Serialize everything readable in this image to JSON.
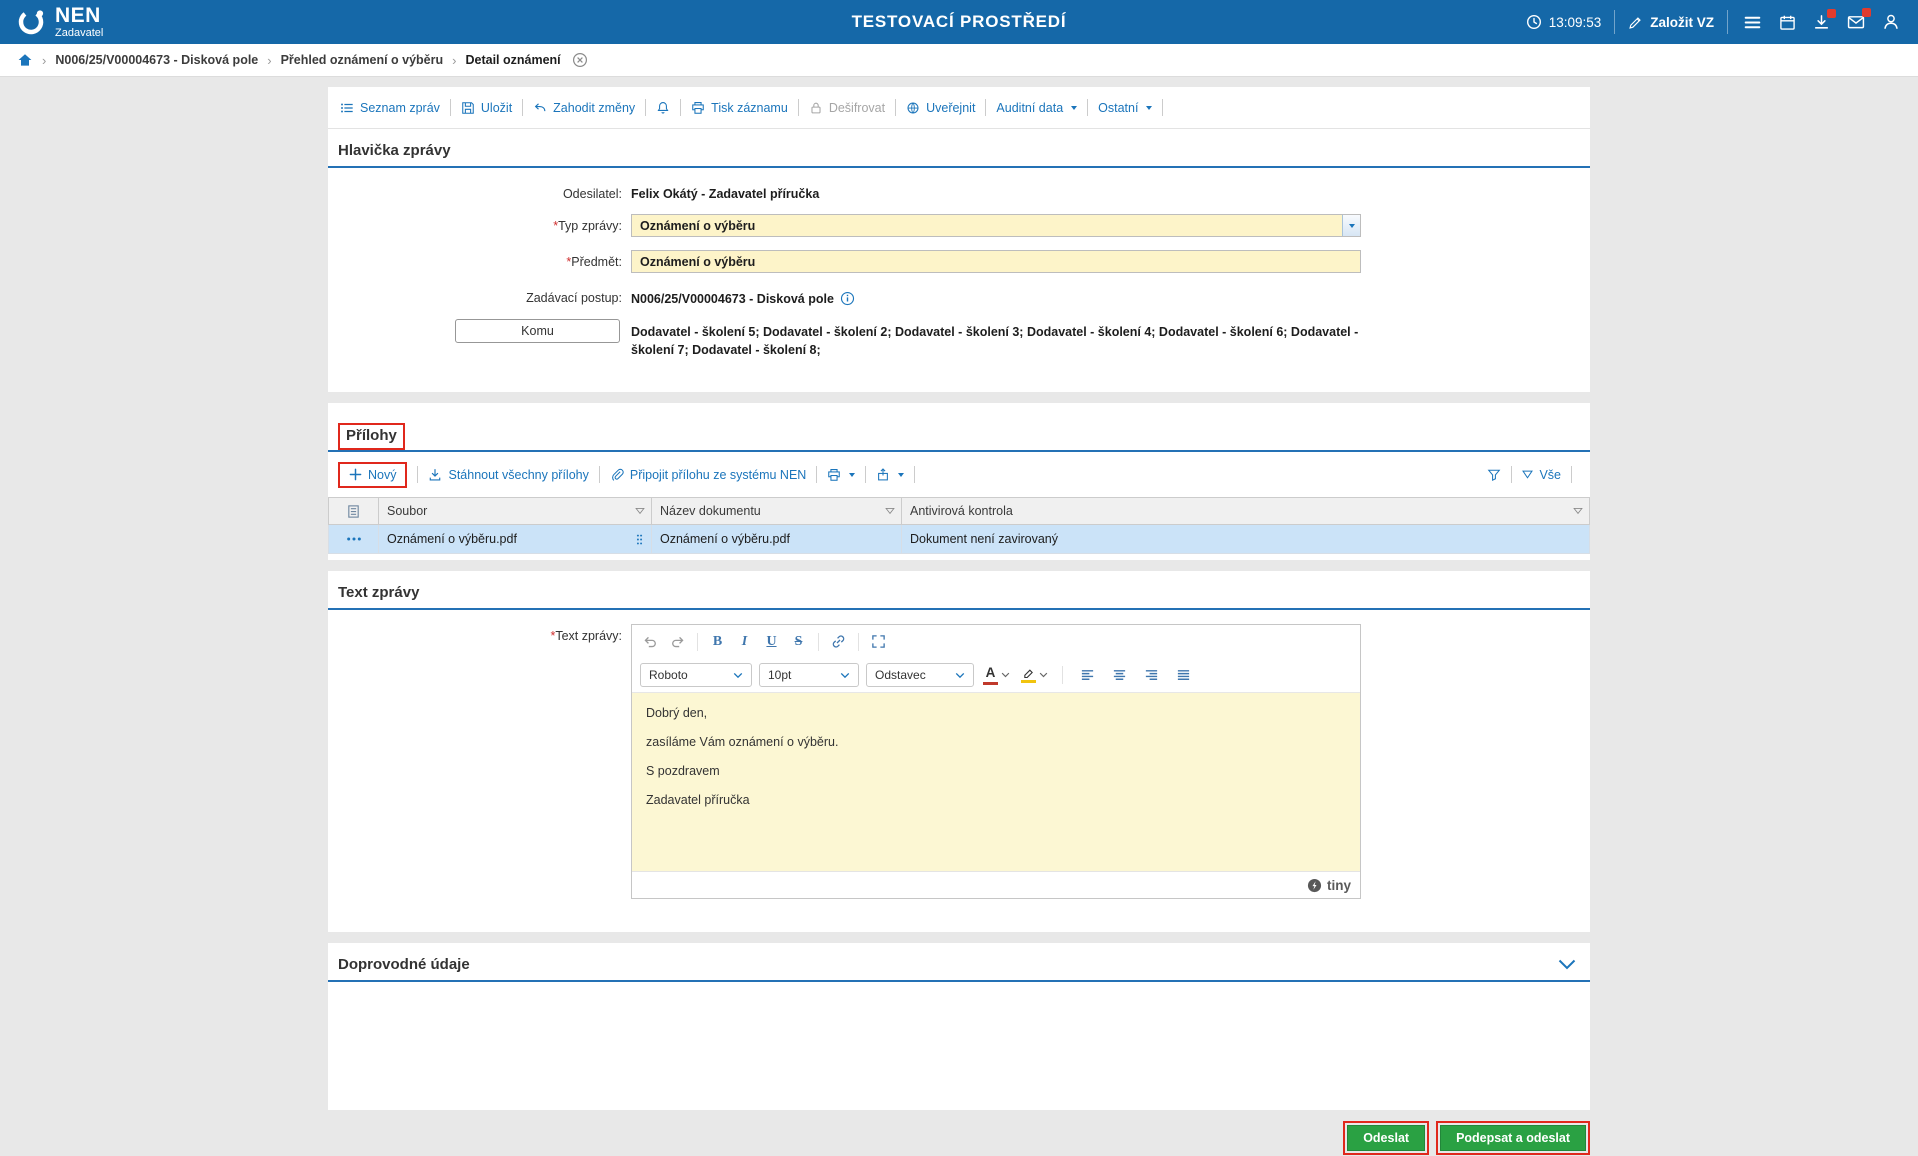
{
  "topbar": {
    "brand": "NEN",
    "brand_sub": "Zadavatel",
    "environment": "TESTOVACÍ PROSTŘEDÍ",
    "time": "13:09:53",
    "create_vz": "Založit VZ"
  },
  "breadcrumb": {
    "separator": "›",
    "items": [
      "N006/25/V00004673 - Disková pole",
      "Přehled oznámení o výběru",
      "Detail oznámení"
    ]
  },
  "toolbar": {
    "items": [
      {
        "label": "Seznam zpráv"
      },
      {
        "label": "Uložit"
      },
      {
        "label": "Zahodit změny"
      },
      {
        "label": "Tisk záznamu"
      },
      {
        "label": "Dešifrovat"
      },
      {
        "label": "Uveřejnit"
      },
      {
        "label": "Auditní data"
      },
      {
        "label": "Ostatní"
      }
    ]
  },
  "required_mark": "*",
  "header_section": {
    "title": "Hlavička zprávy",
    "rows": {
      "odesilatel": {
        "label": "Odesilatel:",
        "value": "Felix Okátý - Zadavatel příručka"
      },
      "typ_zpravy": {
        "label": "Typ zprávy:",
        "value": "Oznámení o výběru"
      },
      "predmet": {
        "label": "Předmět:",
        "value": "Oznámení o výběru"
      },
      "zadavaci_postup": {
        "label": "Zadávací postup:",
        "value": "N006/25/V00004673 - Disková pole"
      },
      "komu": {
        "label": "Komu",
        "value": "Dodavatel - školení 5; Dodavatel - školení 2; Dodavatel - školení 3; Dodavatel - školení 4; Dodavatel - školení 6; Dodavatel - školení 7; Dodavatel - školení 8;"
      }
    }
  },
  "attachments": {
    "title": "Přílohy",
    "toolbar": {
      "novy": "Nový",
      "stahnout": "Stáhnout všechny přílohy",
      "pripojit": "Připojit přílohu ze systému NEN",
      "vse": "Vše"
    },
    "columns": [
      "Soubor",
      "Název dokumentu",
      "Antivirová kontrola"
    ],
    "rows": [
      {
        "soubor": "Oznámení o výběru.pdf",
        "nazev_dokumentu": "Oznámení o výběru.pdf",
        "antivirova_kontrola": "Dokument není zavirovaný"
      }
    ]
  },
  "text_zpravy": {
    "title": "Text zprávy",
    "label": "Text zprávy:",
    "editor": {
      "font_name": "Roboto",
      "font_size": "10pt",
      "block_format": "Odstavec",
      "paragraphs": [
        "Dobrý den,",
        "zasíláme Vám oznámení o výběru.",
        "S pozdravem",
        "Zadavatel příručka"
      ],
      "brand": "tiny"
    }
  },
  "doprovodne_udaje": {
    "title": "Doprovodné údaje"
  },
  "footer": {
    "odeslat": "Odeslat",
    "podepsat_a_odeslat": "Podepsat a odeslat"
  },
  "colors": {
    "topbar_blue": "#1568a8",
    "link_blue": "#1b75bb",
    "section_underline": "#2471b5",
    "input_yellow": "#fdf4c9",
    "selected_row": "#cbe3f8",
    "annotation_red": "#e0281c",
    "button_green": "#2aa143"
  }
}
